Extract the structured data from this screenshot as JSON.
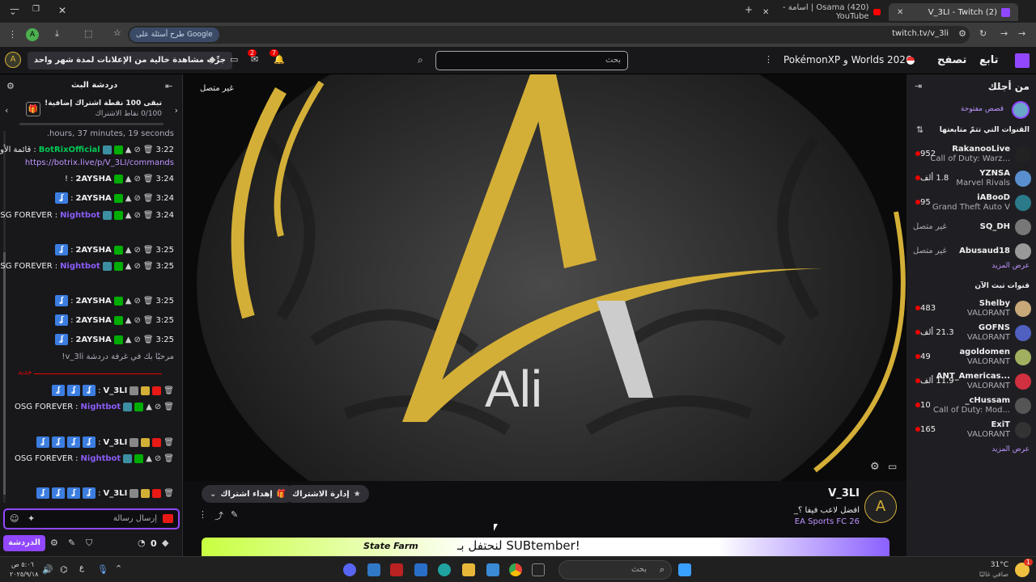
{
  "browser": {
    "tabs": [
      {
        "label": "(2) V_3LI - Twitch",
        "active": true
      },
      {
        "label": "(420) Osama | اسامة - YouTube",
        "active": false
      }
    ],
    "url": "twitch.tv/v_3li",
    "google_button": "طرح أسئلة على Google",
    "profile_initial": "A"
  },
  "header": {
    "logo": "twitch-logo",
    "nav": [
      "تابع",
      "تصفح"
    ],
    "promo": "PokémonXP و Worlds 2026",
    "search_placeholder": "بحث",
    "notif_count": "7",
    "inbox_count": "2",
    "ads_offer": "جرِّب مشاهدة خالية من الإعلانات لمدة شهر واحد"
  },
  "chat": {
    "title": "دردشة البث",
    "points_title": "تبقى 100 نقطة اشتراك إضافية!",
    "points_sub": "0/100 نقاط الاشتراك",
    "truncated_top": "hours, 37 minutes, 19 seconds.",
    "messages": [
      {
        "time": "3:22",
        "user": "BotRixOfficial",
        "text": "قائمة الأوامر:",
        "link": "https://botrix.live/p/V_3LI/commands"
      },
      {
        "time": "3:24",
        "user": "2AYSHA",
        "text": "!"
      },
      {
        "time": "3:24",
        "user": "2AYSHA",
        "text": "emote"
      },
      {
        "time": "3:24",
        "user": "Nightbot",
        "text": "OSG FOREVER"
      },
      {
        "time": "3:25",
        "user": "2AYSHA",
        "text": "emote"
      },
      {
        "time": "3:25",
        "user": "Nightbot",
        "text": "OSG FOREVER"
      },
      {
        "time": "3:25",
        "user": "2AYSHA",
        "text": "emote"
      },
      {
        "time": "3:25",
        "user": "2AYSHA",
        "text": "emote"
      },
      {
        "time": "3:25",
        "user": "2AYSHA",
        "text": "emote"
      }
    ],
    "welcome": "مرحبًا بك في غرفة دردشة v_3li!",
    "new_divider": "جديد",
    "new_messages": [
      {
        "user": "V_3LI",
        "text": "emotes"
      },
      {
        "user": "Nightbot",
        "text": "OSG FOREVER"
      },
      {
        "user": "V_3LI",
        "text": "emotes"
      },
      {
        "user": "Nightbot",
        "text": "OSG FOREVER"
      },
      {
        "user": "V_3LI",
        "text": "emotes"
      }
    ],
    "input_placeholder": "إرسال رسالة",
    "send_button": "الدردشة",
    "points_value": "0"
  },
  "player": {
    "status": "غير متصل",
    "logo_text": "Ali"
  },
  "stream_info": {
    "channel": "V_3LI",
    "title": "افضل لاعب فيفا ؟_",
    "game": "EA Sports FC 26",
    "manage_sub": "إدارة الاشتراك",
    "gift_sub": "إهداء اشتراك",
    "banner_text": "لنحتفل بـ SUBtember!",
    "banner_brand": "State Farm"
  },
  "sidebar": {
    "for_you": "من أجلك",
    "stories": "قصص مفتوحة",
    "followed_title": "القنوات التي تتمّ متابعتها",
    "followed": [
      {
        "name": "RakanooLive",
        "game": "Call of Duty: Warz...",
        "viewers": "952",
        "avatar_color": "#222222"
      },
      {
        "name": "YZNSA",
        "game": "Marvel Rivals",
        "viewers": "1.8 ألف",
        "avatar_color": "#5a8fcf"
      },
      {
        "name": "iABooD",
        "game": "Grand Theft Auto V",
        "viewers": "95",
        "avatar_color": "#2a7a8a"
      },
      {
        "name": "SQ_DH",
        "game": "",
        "viewers": "غير متصل",
        "avatar_color": "#777777"
      },
      {
        "name": "Abusaud18",
        "game": "",
        "viewers": "غير متصل",
        "avatar_color": "#999999"
      }
    ],
    "show_more_1": "عرض المزيد",
    "live_title": "قنوات تبث الآن",
    "live": [
      {
        "name": "Shelby",
        "game": "VALORANT",
        "viewers": "483",
        "avatar_color": "#c8a878"
      },
      {
        "name": "GOFNS",
        "game": "VALORANT",
        "viewers": "21.3 ألف",
        "avatar_color": "#5060c0"
      },
      {
        "name": "agoldomen",
        "game": "VALORANT",
        "viewers": "49",
        "avatar_color": "#a0b060"
      },
      {
        "name": "ANT_Americas...",
        "game": "VALORANT",
        "viewers": "11.9 ألف",
        "avatar_color": "#d03040"
      },
      {
        "name": "_cHussam",
        "game": "Call of Duty: Mod...",
        "viewers": "10",
        "avatar_color": "#555555"
      },
      {
        "name": "ExiT",
        "game": "VALORANT",
        "viewers": "165",
        "avatar_color": "#333333"
      }
    ],
    "show_more_2": "عرض المزيد"
  },
  "taskbar": {
    "search_placeholder": "بحث",
    "temperature": "31°C",
    "weather": "صافي غالبًا",
    "time": "٥:٠٦ ص",
    "date": "٢٠٢٥/٩/١٨",
    "lang": "ع",
    "notif_badge": "1"
  },
  "colors": {
    "twitch_purple": "#9147ff",
    "live_red": "#eb0400",
    "gold": "#d4af37"
  }
}
